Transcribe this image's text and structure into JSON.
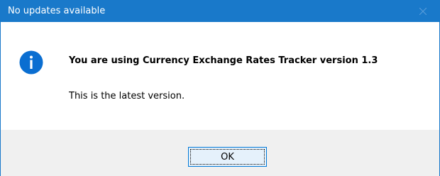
{
  "dialog": {
    "title": "No updates available",
    "heading": "You are using Currency Exchange Rates Tracker version 1.3",
    "message": "This is the latest version.",
    "ok_label": "OK"
  },
  "icons": {
    "info": "info-icon",
    "close": "close-icon"
  },
  "colors": {
    "titlebar": "#1979ca",
    "info_icon": "#0a6ed1",
    "button_border": "#0078d7",
    "button_fill": "#e5f1fb"
  }
}
